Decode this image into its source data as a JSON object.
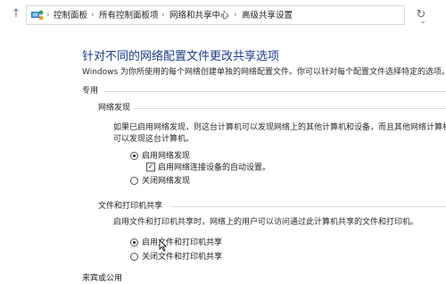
{
  "address_bar": {
    "breadcrumbs": [
      "控制面板",
      "所有控制面板项",
      "网络和共享中心",
      "高级共享设置"
    ],
    "icon": "control-panel-icon",
    "refresh_icon": "refresh-icon",
    "up_icon": "up-arrow-icon"
  },
  "page": {
    "title": "针对不同的网络配置文件更改共享选项",
    "description": "Windows 为你所使用的每个网络创建单独的网络配置文件。你可以针对每个配置文件选择特定的选项。"
  },
  "profile": {
    "name": "专用",
    "network_discovery": {
      "heading": "网络发现",
      "description_line1": "如果已启用网络发现，则这台计算机可以发现网络上的其他计算机和设备，而且其他网络计算机也",
      "description_line2": "可以发现这台计算机。",
      "options": [
        {
          "label": "启用网络发现",
          "selected": true
        },
        {
          "label": "关闭网络发现",
          "selected": false
        }
      ],
      "auto_setup": {
        "label": "启用网络连接设备的自动设置。",
        "checked": true
      }
    },
    "file_printer_sharing": {
      "heading": "文件和打印机共享",
      "description": "启用文件和打印机共享时，网络上的用户可以访问通过此计算机共享的文件和打印机。",
      "options": [
        {
          "label": "启用文件和打印机共享",
          "selected": true
        },
        {
          "label": "关闭文件和打印机共享",
          "selected": false
        }
      ]
    }
  },
  "next_section": {
    "name": "来宾或公用"
  },
  "colors": {
    "title": "#1a3c8c",
    "text": "#1e1e1e"
  }
}
